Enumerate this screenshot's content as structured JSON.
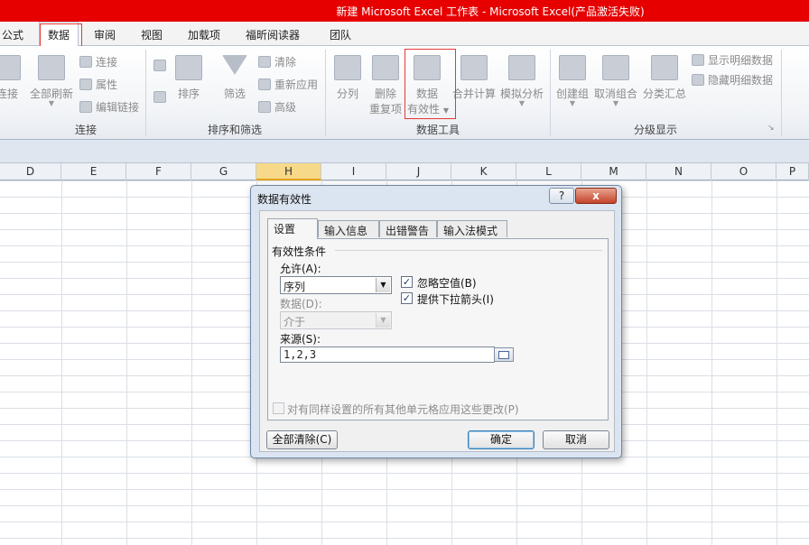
{
  "window": {
    "title": "新建 Microsoft Excel 工作表 - Microsoft Excel(产品激活失败)"
  },
  "tabs": [
    "公式",
    "数据",
    "审阅",
    "视图",
    "加载项",
    "福昕阅读器",
    "团队"
  ],
  "ribbon": {
    "connections": {
      "partial_label": "连接",
      "refresh_all": "全部刷新",
      "connections": "连接",
      "properties": "属性",
      "edit_links": "编辑链接",
      "group_label": "连接"
    },
    "sort_filter": {
      "sort": "排序",
      "filter": "筛选",
      "clear": "清除",
      "reapply": "重新应用",
      "advanced": "高级",
      "group_label": "排序和筛选"
    },
    "data_tools": {
      "text_to_columns": "分列",
      "remove_dup_1": "删除",
      "remove_dup_2": "重复项",
      "validation_1": "数据",
      "validation_2": "有效性",
      "consolidate": "合并计算",
      "what_if": "模拟分析",
      "group_label": "数据工具"
    },
    "outline": {
      "group": "创建组",
      "ungroup": "取消组合",
      "subtotal": "分类汇总",
      "show_detail": "显示明细数据",
      "hide_detail": "隐藏明细数据",
      "group_label": "分级显示"
    }
  },
  "columns": [
    "D",
    "E",
    "F",
    "G",
    "H",
    "I",
    "J",
    "K",
    "L",
    "M",
    "N",
    "O",
    "P"
  ],
  "dialog": {
    "title": "数据有效性",
    "help": "?",
    "close": "x",
    "tabs": [
      "设置",
      "输入信息",
      "出错警告",
      "输入法模式"
    ],
    "section_title": "有效性条件",
    "allow_label": "允许(A):",
    "allow_value": "序列",
    "ignore_blank": "忽略空值(B)",
    "dropdown": "提供下拉箭头(I)",
    "data_label": "数据(D):",
    "data_value": "介于",
    "source_label": "来源(S):",
    "source_value": "1,2,3",
    "apply_all": "对有同样设置的所有其他单元格应用这些更改(P)",
    "clear_all": "全部清除(C)",
    "ok": "确定",
    "cancel": "取消"
  },
  "colors": {
    "titlebar": "#e60000",
    "highlight_box": "#e53935",
    "dialog_bg": "#dbe5f1"
  },
  "icons": [
    "refresh-icon",
    "link-icon",
    "properties-icon",
    "sort-az-icon",
    "sort-za-icon",
    "funnel-icon",
    "text-to-columns-icon",
    "remove-duplicates-icon",
    "data-validation-icon",
    "consolidate-icon",
    "what-if-icon",
    "group-icon",
    "ungroup-icon",
    "subtotal-icon",
    "range-picker-icon"
  ]
}
